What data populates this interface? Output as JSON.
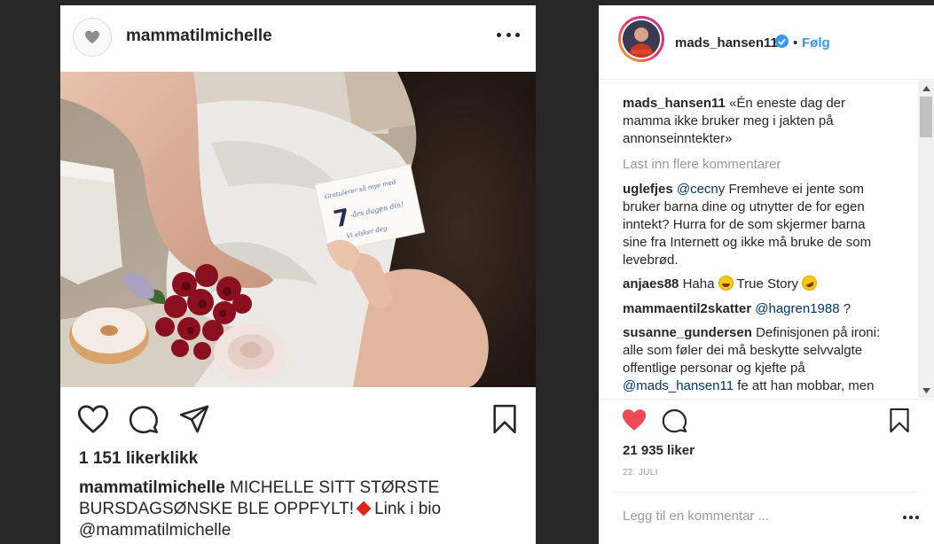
{
  "post": {
    "username": "mammatilmichelle",
    "photo_note": {
      "line1": "Gratulerer så mye med",
      "line2": "-års dagen din!",
      "big_number": "7",
      "line3": "Vi elsker deg"
    },
    "likes": "1 151 likerklikk",
    "caption_user": "mammatilmichelle",
    "caption_text_1": "MICHELLE SITT STØRSTE BURSDAGSØNSKE BLE OPPFYLT!",
    "caption_text_2": "Link i bio",
    "caption_mention": "@mammatilmichelle"
  },
  "panel": {
    "username": "mads_hansen11",
    "dot": "•",
    "follow_label": "Følg",
    "comments": [
      {
        "user": "mads_hansen11",
        "text": "«Én eneste dag der mamma ikke bruker meg i jakten på annonseinntekter»"
      },
      {
        "user": "uglefjes",
        "mention": "@cecny",
        "text": "Fremheve ei jente som bruker barna dine og utnytter de for egen inntekt? Hurra for de som skjermer barna sine fra Internett og ikke må bruke de som levebrød."
      },
      {
        "user": "anjaes88",
        "text_a": "Haha",
        "text_b": "True Story"
      },
      {
        "user": "mammaentil2skatter",
        "mention": "@hagren1988",
        "text": "?"
      },
      {
        "user": "susanne_gundersen",
        "text": "Definisjonen på ironi: alle som føler dei må beskytte selvvalgte offentlige personar og kjefte på",
        "mention": "@mads_hansen11",
        "text_2": "fe att han mobbar, men"
      }
    ],
    "load_more": "Last inn flere kommentarer",
    "likes": "21 935 liker",
    "date": "22. juli",
    "add_comment_placeholder": "Legg til en kommentar ..."
  },
  "colors": {
    "background": "#262626",
    "link_blue": "#3897f0",
    "heart_red": "#ed4956",
    "muted": "#999999"
  },
  "icons": {
    "post_actions": [
      "heart-icon",
      "comment-icon",
      "share-icon",
      "bookmark-icon"
    ],
    "panel_actions": [
      "heart-filled-icon",
      "comment-icon",
      "bookmark-icon"
    ]
  }
}
